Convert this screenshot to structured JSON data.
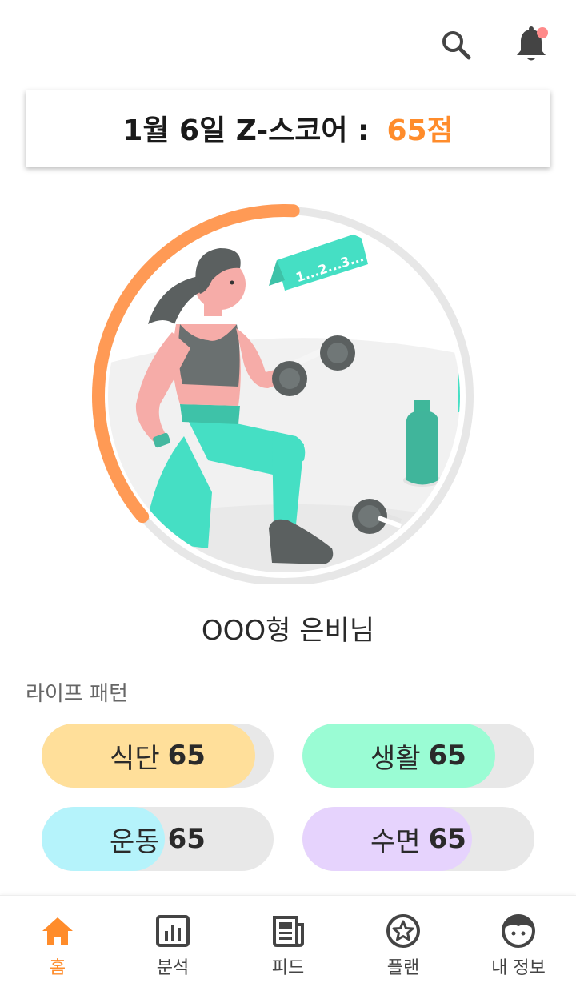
{
  "header": {
    "search_icon": "search-icon",
    "bell_icon": "bell-icon",
    "has_notification": true
  },
  "score_card": {
    "date_label": "1월 6일 Z-스코어 :",
    "score": "65점"
  },
  "hero": {
    "progress_fraction": 0.37,
    "progress_color": "#ff9a55",
    "speech_text": "1...2...3..."
  },
  "user": {
    "name": "OOO형 은비님"
  },
  "life_pattern": {
    "title": "라이프 패턴",
    "items": [
      {
        "label": "식단",
        "value": "65",
        "color": "#ffdf9a",
        "fill": 0.92
      },
      {
        "label": "생활",
        "value": "65",
        "color": "#9afcd4",
        "fill": 0.83
      },
      {
        "label": "운동",
        "value": "65",
        "color": "#b5f3fb",
        "fill": 0.53
      },
      {
        "label": "수면",
        "value": "65",
        "color": "#e6d3fd",
        "fill": 0.73
      }
    ]
  },
  "colors": {
    "accent": "#ff8c2b",
    "nav_inactive": "#444444"
  },
  "nav": {
    "items": [
      {
        "label": "홈",
        "icon": "home-icon",
        "active": true
      },
      {
        "label": "분석",
        "icon": "chart-icon",
        "active": false
      },
      {
        "label": "피드",
        "icon": "feed-icon",
        "active": false
      },
      {
        "label": "플랜",
        "icon": "plan-star-icon",
        "active": false
      },
      {
        "label": "내 정보",
        "icon": "profile-icon",
        "active": false
      }
    ]
  }
}
